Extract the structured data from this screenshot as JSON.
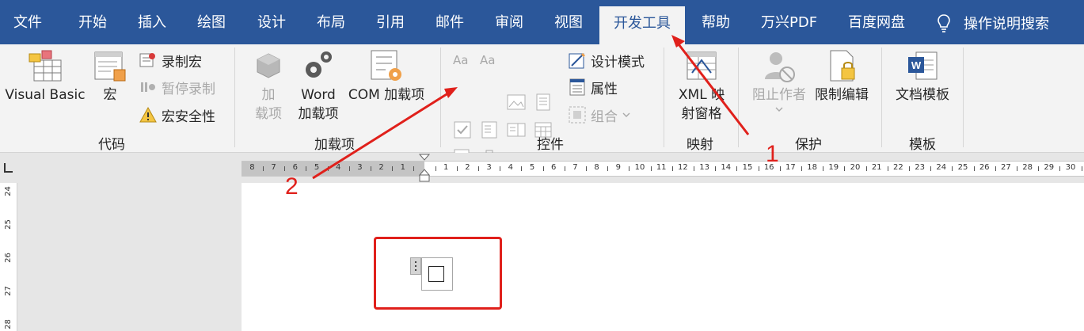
{
  "tabs": [
    "文件",
    "开始",
    "插入",
    "绘图",
    "设计",
    "布局",
    "引用",
    "邮件",
    "审阅",
    "视图",
    "开发工具",
    "帮助",
    "万兴PDF",
    "百度网盘"
  ],
  "active_tab": "开发工具",
  "tell_me": "操作说明搜索",
  "groups": {
    "code": {
      "label": "代码",
      "visual_basic": "Visual Basic",
      "macros": "宏",
      "record_macro": "录制宏",
      "pause_recording": "暂停录制",
      "macro_security": "宏安全性"
    },
    "addins": {
      "label": "加载项",
      "addins": "加\n载项",
      "word_addins": "Word\n加载项",
      "com_addins": "COM 加载项"
    },
    "controls": {
      "label": "控件",
      "design_mode": "设计模式",
      "properties": "属性",
      "group": "组合",
      "rich_text": "Aa",
      "plain_text": "Aa"
    },
    "mapping": {
      "label": "映射",
      "xml_mapping": "XML 映\n射窗格"
    },
    "protect": {
      "label": "保护",
      "block_authors": "阻止作者",
      "restrict_editing": "限制编辑"
    },
    "templates": {
      "label": "模板",
      "document_template": "文档模板"
    }
  },
  "ruler": {
    "left_labels": [
      "8",
      "7",
      "6",
      "5",
      "4",
      "3",
      "2",
      "1"
    ],
    "right_labels": [
      "1",
      "2",
      "3",
      "4",
      "5",
      "6",
      "7",
      "8",
      "9",
      "10",
      "11",
      "12",
      "13",
      "14",
      "15",
      "16",
      "17",
      "18",
      "19",
      "20",
      "21",
      "22",
      "23",
      "24",
      "25",
      "26",
      "27",
      "28",
      "29",
      "30"
    ],
    "vertical_labels": [
      "24",
      "25",
      "26",
      "27",
      "28"
    ]
  },
  "annotations": {
    "one": "1",
    "two": "2"
  },
  "colors": {
    "tab_bar": "#2b579a",
    "ribbon": "#f3f3f3",
    "annotation_red": "#e0201b"
  }
}
